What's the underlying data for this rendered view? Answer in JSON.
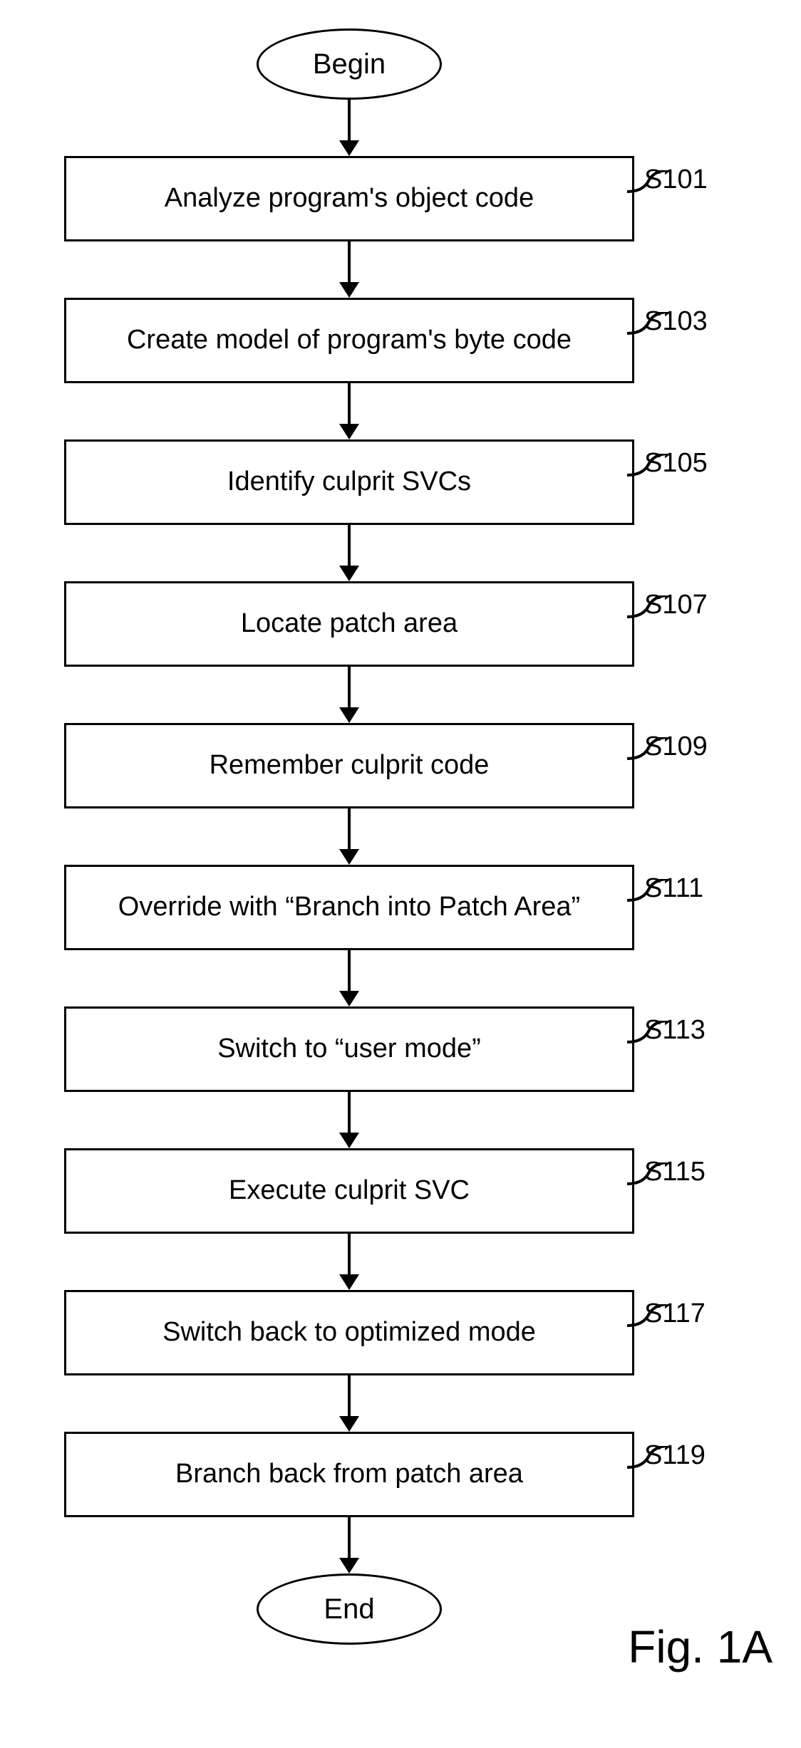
{
  "chart_data": {
    "type": "flowchart",
    "title": "Fig. 1A",
    "begin": "Begin",
    "end": "End",
    "steps": [
      {
        "id": "S101",
        "text": "Analyze program's object code"
      },
      {
        "id": "S103",
        "text": "Create model of program's byte code"
      },
      {
        "id": "S105",
        "text": "Identify culprit SVCs"
      },
      {
        "id": "S107",
        "text": "Locate patch area"
      },
      {
        "id": "S109",
        "text": "Remember culprit code"
      },
      {
        "id": "S111",
        "text": "Override with “Branch into Patch Area”"
      },
      {
        "id": "S113",
        "text": "Switch to “user mode”"
      },
      {
        "id": "S115",
        "text": "Execute culprit SVC"
      },
      {
        "id": "S117",
        "text": "Switch back to optimized mode"
      },
      {
        "id": "S119",
        "text": "Branch back from patch area"
      }
    ]
  }
}
